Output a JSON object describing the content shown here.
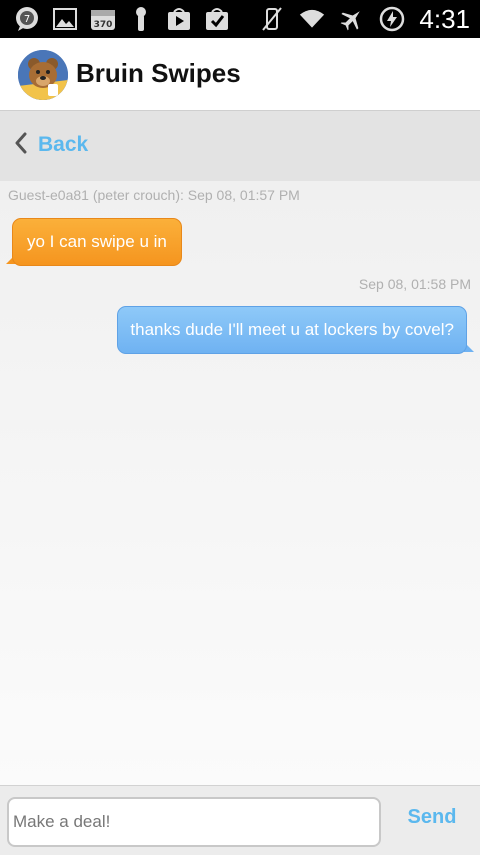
{
  "status_bar": {
    "time": "4:31",
    "left_icons": [
      "chat-bubble-notification-icon",
      "image-icon",
      "calendar-370-icon",
      "keyhole-icon",
      "play-store-icon",
      "checklist-bag-icon"
    ],
    "left_badge_1": "7",
    "left_badge_3": "370",
    "right_icons": [
      "vibrate-off-icon",
      "wifi-icon",
      "airplane-icon",
      "battery-charging-icon"
    ]
  },
  "app_bar": {
    "title": "Bruin Swipes",
    "logo_icon": "bruin-bear-logo"
  },
  "nav": {
    "back_label": "Back"
  },
  "messages": [
    {
      "direction": "incoming",
      "meta": "Guest-e0a81 (peter crouch): Sep 08, 01:57 PM",
      "text": "yo I can swipe u in",
      "color": "#f7a12b"
    },
    {
      "direction": "outgoing",
      "meta": "Sep 08, 01:58 PM",
      "text": "thanks dude I'll meet u at lockers by covel?",
      "color": "#7dbdf5"
    }
  ],
  "composer": {
    "placeholder": "Make a deal!",
    "value": "",
    "send_label": "Send"
  },
  "colors": {
    "accent": "#5bb8ee",
    "incoming_bubble": "#f7a12b",
    "outgoing_bubble": "#7dbdf5",
    "status_bar": "#000000"
  }
}
